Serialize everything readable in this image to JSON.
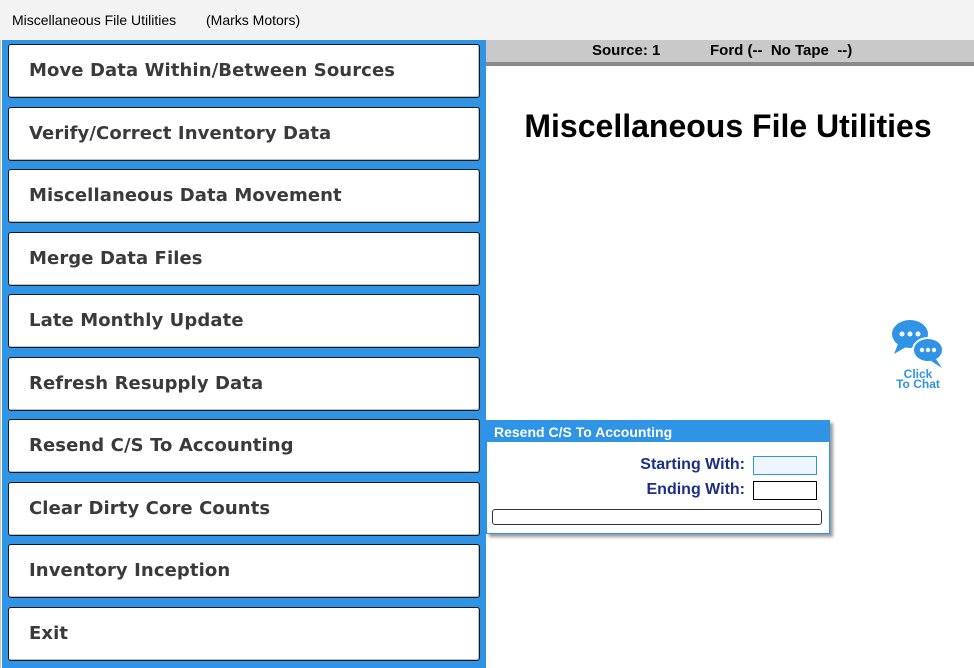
{
  "window": {
    "title": "Miscellaneous File Utilities",
    "company": "(Marks Motors)"
  },
  "menu": {
    "items": [
      {
        "label": "Move Data Within/Between Sources"
      },
      {
        "label": "Verify/Correct Inventory Data"
      },
      {
        "label": "Miscellaneous Data Movement"
      },
      {
        "label": "Merge Data Files"
      },
      {
        "label": "Late Monthly Update"
      },
      {
        "label": "Refresh Resupply Data"
      },
      {
        "label": "Resend C/S To Accounting"
      },
      {
        "label": "Clear Dirty Core Counts"
      },
      {
        "label": "Inventory Inception"
      },
      {
        "label": "Exit"
      }
    ]
  },
  "status": {
    "source": "Source: 1",
    "tape": "Ford (--  No Tape  --)"
  },
  "main": {
    "heading": "Miscellaneous File Utilities"
  },
  "chat": {
    "line1": "Click",
    "line2": "To Chat",
    "icon": "chat-bubbles-icon"
  },
  "dialog": {
    "title": "Resend C/S To Accounting",
    "starting_label": "Starting With:",
    "starting_value": "",
    "ending_label": "Ending With:",
    "ending_value": "",
    "progress": 0
  },
  "colors": {
    "accent": "#2f93e6",
    "label": "#1c2f86",
    "status_bg": "#c9c9c9"
  }
}
